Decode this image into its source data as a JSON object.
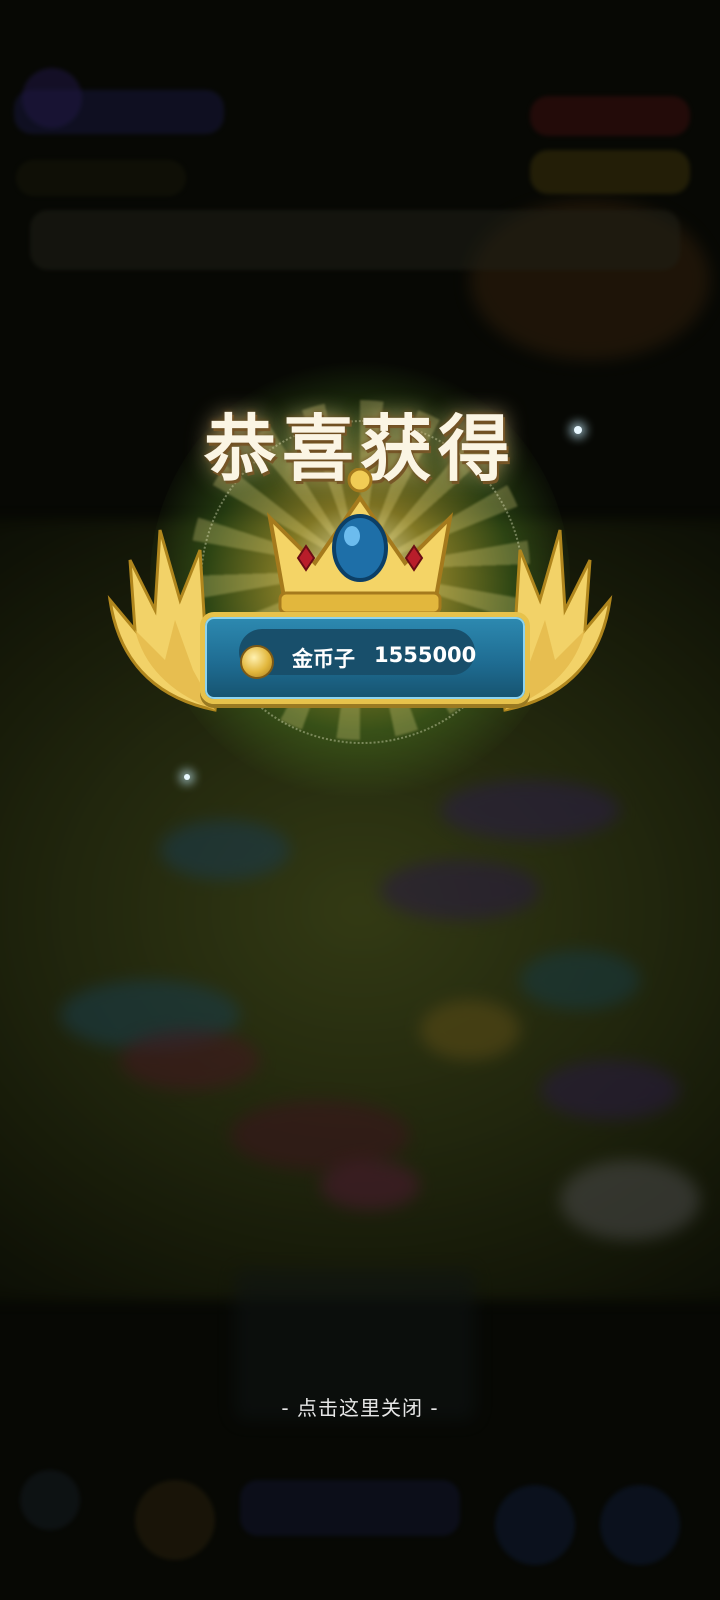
{
  "popup": {
    "title": "恭喜获得",
    "reward_name": "金币子",
    "reward_amount": "1555000",
    "close_hint": "- 点击这里关闭 -"
  },
  "icons": {
    "crown": "crown-icon",
    "coin": "gold-coin-icon",
    "wings": "wing-icon"
  },
  "colors": {
    "ribbon": "#1f6d93",
    "ribbon_border": "#e7c24b",
    "title": "#fbf5e4",
    "overlay": "#000000"
  }
}
